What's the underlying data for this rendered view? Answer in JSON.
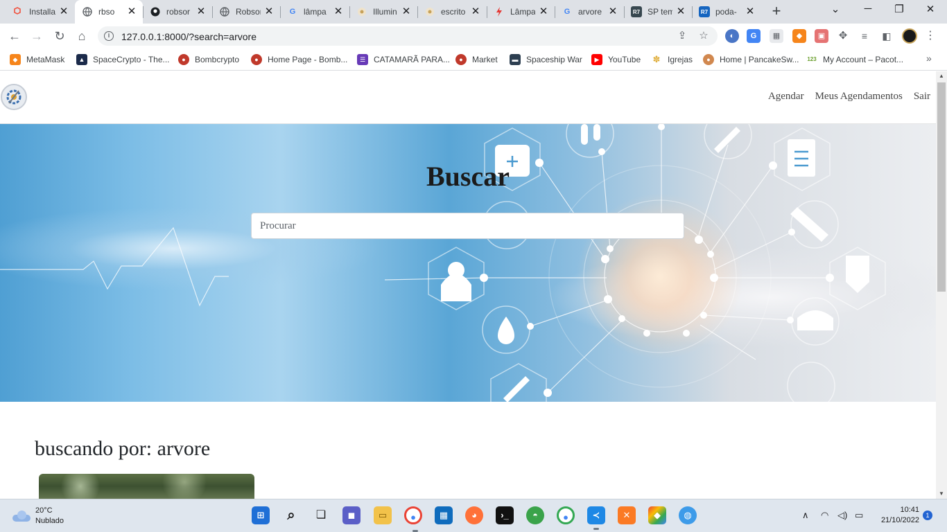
{
  "browser": {
    "tabs": [
      {
        "label": "Installa",
        "icon": "laravel-icon",
        "color": "#f05340"
      },
      {
        "label": "rbso",
        "icon": "globe-icon",
        "color": "#5f6368",
        "active": true
      },
      {
        "label": "robsor",
        "icon": "github-icon",
        "color": "#1b1f23"
      },
      {
        "label": "Robsor",
        "icon": "globe-icon",
        "color": "#5f6368"
      },
      {
        "label": "lâmpa",
        "icon": "google-icon",
        "color": "#4285f4"
      },
      {
        "label": "Illumin",
        "icon": "site-icon",
        "color": "#c7a25a"
      },
      {
        "label": "escrito",
        "icon": "site-icon",
        "color": "#c7a25a"
      },
      {
        "label": "Lâmpa",
        "icon": "bolt-icon",
        "color": "#e53935"
      },
      {
        "label": "arvore",
        "icon": "google-icon",
        "color": "#4285f4"
      },
      {
        "label": "SP tem",
        "icon": "r7-icon",
        "color": "#37474f"
      },
      {
        "label": "poda-",
        "icon": "r7-icon",
        "color": "#1565c0"
      }
    ],
    "url": "127.0.0.1:8000/?search=arvore"
  },
  "bookmarks": [
    {
      "label": "MetaMask",
      "icon": "metamask-icon",
      "color": "#f6851b"
    },
    {
      "label": "SpaceCrypto - The...",
      "icon": "spacecrypto-icon",
      "color": "#1b2a4a"
    },
    {
      "label": "Bombcrypto",
      "icon": "bombcrypto-icon",
      "color": "#c0392b"
    },
    {
      "label": "Home Page - Bomb...",
      "icon": "bombcrypto-icon",
      "color": "#c0392b"
    },
    {
      "label": "CATAMARÃ PARA...",
      "icon": "forms-icon",
      "color": "#673ab7"
    },
    {
      "label": "Market",
      "icon": "bombcrypto-icon",
      "color": "#c0392b"
    },
    {
      "label": "Spaceship War",
      "icon": "spaceship-icon",
      "color": "#2c3e50"
    },
    {
      "label": "YouTube",
      "icon": "youtube-icon",
      "color": "#ff0000"
    },
    {
      "label": "Igrejas",
      "icon": "wheat-icon",
      "color": "#e0b040"
    },
    {
      "label": "Home | PancakeSw...",
      "icon": "pancake-icon",
      "color": "#d1884f"
    },
    {
      "label": "My Account – Pacot...",
      "icon": "123-icon",
      "color": "#8bc34a"
    }
  ],
  "site": {
    "nav": [
      "Agendar",
      "Meus Agendamentos",
      "Sair"
    ],
    "hero_title": "Buscar",
    "search_placeholder": "Procurar",
    "results_title": "buscando por: arvore"
  },
  "taskbar": {
    "temperature": "20°C",
    "weather": "Nublado",
    "time": "10:41",
    "date": "21/10/2022",
    "notifications": "1"
  }
}
